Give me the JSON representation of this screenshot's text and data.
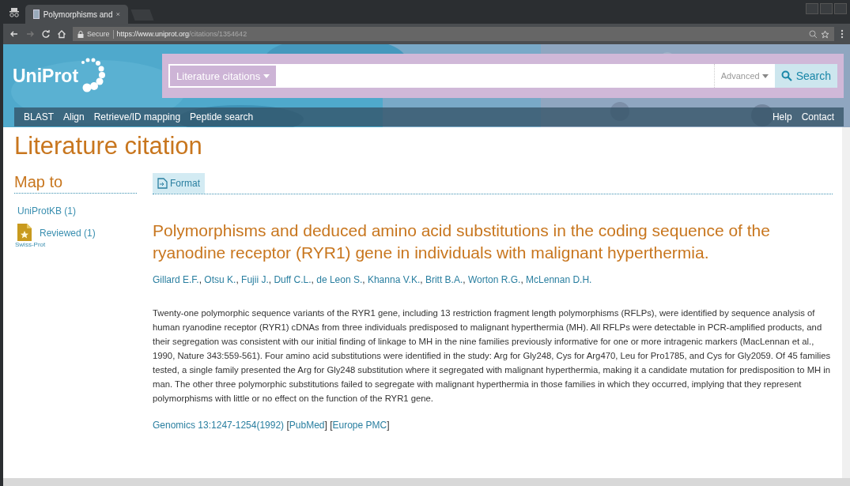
{
  "browser": {
    "tab_title": "Polymorphisms and",
    "secure_label": "Secure",
    "url_host": "https://www.uniprot.org",
    "url_path": "/citations/1354642"
  },
  "header": {
    "logo": "UniProt",
    "search": {
      "scope": "Literature citations",
      "advanced": "Advanced",
      "button": "Search"
    },
    "nav_left": [
      "BLAST",
      "Align",
      "Retrieve/ID mapping",
      "Peptide search"
    ],
    "nav_right": [
      "Help",
      "Contact"
    ]
  },
  "page_title": "Literature citation",
  "sidebar": {
    "title": "Map to",
    "items": [
      {
        "label": "UniProtKB (1)",
        "kind": "link"
      },
      {
        "label": "Reviewed (1)",
        "sublabel": "Swiss-Prot",
        "kind": "reviewed"
      }
    ]
  },
  "toolbar": {
    "tabs": [
      {
        "label": "Format",
        "selected": true
      }
    ]
  },
  "article": {
    "title": "Polymorphisms and deduced amino acid substitutions in the coding sequence of the ryanodine receptor (RYR1) gene in individuals with malignant hyperthermia.",
    "author_separator": ", ",
    "authors": [
      "Gillard E.F.",
      "Otsu K.",
      "Fujii J.",
      "Duff C.L.",
      "de Leon S.",
      "Khanna V.K.",
      "Britt B.A.",
      "Worton R.G.",
      "McLennan D.H."
    ],
    "abstract": "Twenty-one polymorphic sequence variants of the RYR1 gene, including 13 restriction fragment length polymorphisms (RFLPs), were identified by sequence analysis of human ryanodine receptor (RYR1) cDNAs from three individuals predisposed to malignant hyperthermia (MH). All RFLPs were detectable in PCR-amplified products, and their segregation was consistent with our initial finding of linkage to MH in the nine families previously informative for one or more intragenic markers (MacLennan et al., 1990, Nature 343:559-561). Four amino acid substitutions were identified in the study: Arg for Gly248, Cys for Arg470, Leu for Pro1785, and Cys for Gly2059. Of 45 families tested, a single family presented the Arg for Gly248 substitution where it segregated with malignant hyperthermia, making it a candidate mutation for predisposition to MH in man. The other three polymorphic substitutions failed to segregate with malignant hyperthermia in those families in which they occurred, implying that they represent polymorphisms with little or no effect on the function of the RYR1 gene.",
    "citation": {
      "journal": "Genomics 13:1247-1254(1992)",
      "links": [
        {
          "before": " [",
          "label": "PubMed",
          "after": "]"
        },
        {
          "before": " [",
          "label": "Europe PMC",
          "after": "]"
        }
      ]
    }
  }
}
